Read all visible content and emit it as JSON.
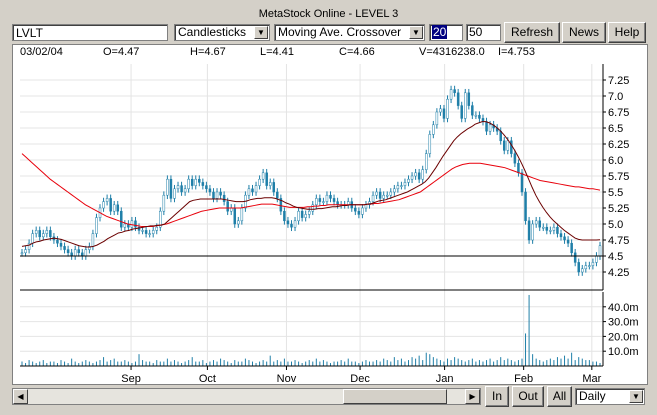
{
  "window": {
    "title": "MetaStock Online - LEVEL 3"
  },
  "toolbar": {
    "symbol": "LVLT",
    "chart_type": "Candlesticks",
    "indicator": "Moving Ave. Crossover",
    "period_fast": "20",
    "period_slow": "50",
    "refresh_label": "Refresh",
    "news_label": "News",
    "help_label": "Help"
  },
  "info_bar": {
    "date": "03/02/04",
    "open": "O=4.47",
    "high": "H=4.67",
    "low": "L=4.41",
    "close": "C=4.66",
    "volume": "V=4316238.0",
    "indicator": "I=4.753"
  },
  "bottom": {
    "in_label": "In",
    "out_label": "Out",
    "all_label": "All",
    "interval": "Daily"
  },
  "chart_data": {
    "type": "candlestick",
    "price_axis": {
      "ticks": [
        "7.25",
        "7.0",
        "6.75",
        "6.5",
        "6.25",
        "6.0",
        "5.75",
        "5.5",
        "5.25",
        "5.0",
        "4.75",
        "4.5",
        "4.25"
      ],
      "range": [
        4.0,
        7.5
      ]
    },
    "volume_axis": {
      "ticks": [
        "40.0m",
        "30.0m",
        "20.0m",
        "10.0m"
      ],
      "range": [
        0,
        50
      ]
    },
    "x_tick_labels": [
      "Sep",
      "Oct",
      "Nov",
      "Dec",
      "Jan",
      "Feb",
      "Mar"
    ],
    "reference_line": 4.5,
    "close": [
      4.55,
      4.6,
      4.7,
      4.85,
      4.9,
      4.8,
      4.85,
      4.9,
      4.8,
      4.75,
      4.7,
      4.65,
      4.6,
      4.55,
      4.5,
      4.6,
      4.55,
      4.5,
      4.6,
      4.65,
      4.85,
      5.1,
      5.25,
      5.35,
      5.4,
      5.2,
      5.3,
      5.2,
      4.95,
      5.0,
      4.95,
      5.05,
      4.95,
      4.9,
      4.9,
      4.85,
      4.85,
      4.9,
      4.95,
      5.2,
      5.45,
      5.7,
      5.4,
      5.55,
      5.6,
      5.5,
      5.55,
      5.7,
      5.6,
      5.7,
      5.65,
      5.6,
      5.55,
      5.5,
      5.4,
      5.5,
      5.45,
      5.35,
      5.2,
      5.25,
      5.0,
      5.05,
      5.25,
      5.45,
      5.55,
      5.5,
      5.6,
      5.7,
      5.8,
      5.6,
      5.65,
      5.5,
      5.4,
      5.2,
      5.05,
      5.0,
      4.95,
      5.05,
      5.2,
      5.1,
      5.15,
      5.2,
      5.3,
      5.4,
      5.35,
      5.35,
      5.45,
      5.4,
      5.35,
      5.3,
      5.3,
      5.3,
      5.35,
      5.25,
      5.2,
      5.15,
      5.25,
      5.3,
      5.35,
      5.45,
      5.5,
      5.4,
      5.45,
      5.45,
      5.5,
      5.55,
      5.6,
      5.6,
      5.65,
      5.7,
      5.75,
      5.8,
      5.7,
      5.85,
      6.1,
      6.4,
      6.55,
      6.75,
      6.8,
      6.65,
      6.95,
      7.1,
      7.05,
      6.85,
      6.65,
      7.05,
      6.85,
      6.7,
      6.7,
      6.65,
      6.6,
      6.45,
      6.55,
      6.5,
      6.45,
      6.3,
      6.15,
      6.3,
      6.1,
      5.95,
      5.8,
      5.5,
      5.05,
      4.75,
      5.0,
      5.05,
      4.95,
      4.95,
      4.9,
      4.9,
      4.95,
      4.85,
      4.8,
      4.75,
      4.7,
      4.55,
      4.4,
      4.25,
      4.3,
      4.35,
      4.35,
      4.4,
      4.5,
      4.66
    ],
    "ma_fast": [
      4.65,
      4.66,
      4.67,
      4.7,
      4.72,
      4.73,
      4.75,
      4.76,
      4.77,
      4.78,
      4.77,
      4.76,
      4.74,
      4.72,
      4.7,
      4.68,
      4.66,
      4.65,
      4.64,
      4.64,
      4.65,
      4.67,
      4.7,
      4.73,
      4.77,
      4.8,
      4.83,
      4.86,
      4.87,
      4.89,
      4.9,
      4.92,
      4.93,
      4.94,
      4.95,
      4.96,
      4.97,
      4.97,
      4.98,
      4.98,
      5.0,
      5.05,
      5.1,
      5.15,
      5.2,
      5.25,
      5.3,
      5.35,
      5.37,
      5.38,
      5.39,
      5.39,
      5.39,
      5.39,
      5.39,
      5.39,
      5.39,
      5.38,
      5.37,
      5.36,
      5.35,
      5.35,
      5.35,
      5.36,
      5.38,
      5.39,
      5.4,
      5.4,
      5.41,
      5.41,
      5.41,
      5.4,
      5.38,
      5.36,
      5.33,
      5.31,
      5.28,
      5.26,
      5.25,
      5.24,
      5.23,
      5.23,
      5.23,
      5.24,
      5.24,
      5.25,
      5.26,
      5.27,
      5.27,
      5.28,
      5.29,
      5.29,
      5.3,
      5.3,
      5.3,
      5.3,
      5.3,
      5.31,
      5.32,
      5.34,
      5.36,
      5.37,
      5.38,
      5.4,
      5.42,
      5.44,
      5.46,
      5.48,
      5.5,
      5.53,
      5.56,
      5.59,
      5.62,
      5.66,
      5.72,
      5.8,
      5.88,
      5.97,
      6.06,
      6.14,
      6.22,
      6.3,
      6.36,
      6.41,
      6.45,
      6.49,
      6.52,
      6.56,
      6.58,
      6.6,
      6.6,
      6.58,
      6.55,
      6.51,
      6.46,
      6.4,
      6.33,
      6.25,
      6.16,
      6.06,
      5.95,
      5.83,
      5.7,
      5.57,
      5.45,
      5.35,
      5.26,
      5.18,
      5.11,
      5.05,
      5.0,
      4.95,
      4.9,
      4.86,
      4.82,
      4.78,
      4.76,
      4.75,
      4.75,
      4.75,
      4.75,
      4.75,
      4.753
    ],
    "ma_slow": [
      6.1,
      6.05,
      6.0,
      5.95,
      5.9,
      5.85,
      5.8,
      5.75,
      5.7,
      5.66,
      5.62,
      5.58,
      5.54,
      5.5,
      5.46,
      5.42,
      5.38,
      5.34,
      5.3,
      5.27,
      5.24,
      5.21,
      5.18,
      5.15,
      5.12,
      5.1,
      5.08,
      5.06,
      5.04,
      5.02,
      5.0,
      4.99,
      4.98,
      4.97,
      4.96,
      4.96,
      4.96,
      4.96,
      4.97,
      4.98,
      4.99,
      5.0,
      5.02,
      5.04,
      5.06,
      5.08,
      5.1,
      5.12,
      5.14,
      5.16,
      5.18,
      5.2,
      5.21,
      5.22,
      5.23,
      5.24,
      5.25,
      5.25,
      5.25,
      5.25,
      5.25,
      5.25,
      5.25,
      5.26,
      5.27,
      5.28,
      5.29,
      5.3,
      5.31,
      5.31,
      5.31,
      5.31,
      5.3,
      5.29,
      5.28,
      5.27,
      5.26,
      5.26,
      5.26,
      5.26,
      5.26,
      5.27,
      5.27,
      5.28,
      5.28,
      5.29,
      5.29,
      5.3,
      5.3,
      5.3,
      5.3,
      5.3,
      5.3,
      5.3,
      5.3,
      5.3,
      5.3,
      5.3,
      5.31,
      5.31,
      5.32,
      5.32,
      5.33,
      5.34,
      5.35,
      5.36,
      5.37,
      5.38,
      5.4,
      5.42,
      5.44,
      5.46,
      5.48,
      5.5,
      5.54,
      5.58,
      5.62,
      5.66,
      5.7,
      5.74,
      5.78,
      5.82,
      5.86,
      5.89,
      5.91,
      5.93,
      5.94,
      5.95,
      5.95,
      5.95,
      5.95,
      5.94,
      5.93,
      5.92,
      5.91,
      5.9,
      5.89,
      5.88,
      5.86,
      5.84,
      5.82,
      5.8,
      5.78,
      5.76,
      5.74,
      5.72,
      5.7,
      5.68,
      5.67,
      5.66,
      5.65,
      5.64,
      5.63,
      5.62,
      5.61,
      5.6,
      5.59,
      5.58,
      5.58,
      5.57,
      5.56,
      5.55,
      5.55,
      5.54,
      5.53
    ],
    "volume": [
      3,
      2,
      4,
      3,
      2,
      3,
      4,
      2,
      3,
      3,
      2,
      4,
      3,
      2,
      5,
      3,
      2,
      3,
      4,
      3,
      2,
      3,
      4,
      6,
      3,
      4,
      5,
      3,
      3,
      4,
      3,
      2,
      3,
      8,
      4,
      3,
      3,
      2,
      4,
      3,
      3,
      5,
      3,
      4,
      3,
      2,
      3,
      4,
      6,
      3,
      3,
      4,
      2,
      3,
      4,
      3,
      5,
      4,
      3,
      2,
      4,
      3,
      3,
      5,
      4,
      3,
      2,
      3,
      4,
      3,
      7,
      3,
      4,
      3,
      5,
      3,
      3,
      4,
      3,
      2,
      3,
      4,
      3,
      5,
      3,
      4,
      3,
      2,
      3,
      3,
      4,
      3,
      5,
      3,
      3,
      2,
      3,
      4,
      3,
      3,
      4,
      3,
      5,
      4,
      3,
      6,
      4,
      5,
      3,
      4,
      6,
      5,
      7,
      4,
      9,
      8,
      6,
      5,
      4,
      3,
      5,
      4,
      6,
      5,
      4,
      3,
      4,
      5,
      3,
      4,
      3,
      4,
      5,
      3,
      4,
      6,
      4,
      5,
      4,
      3,
      4,
      5,
      22,
      48,
      8,
      5,
      4,
      3,
      4,
      5,
      4,
      6,
      5,
      7,
      5,
      9,
      4,
      6,
      5,
      4,
      4,
      3,
      3,
      2
    ]
  }
}
